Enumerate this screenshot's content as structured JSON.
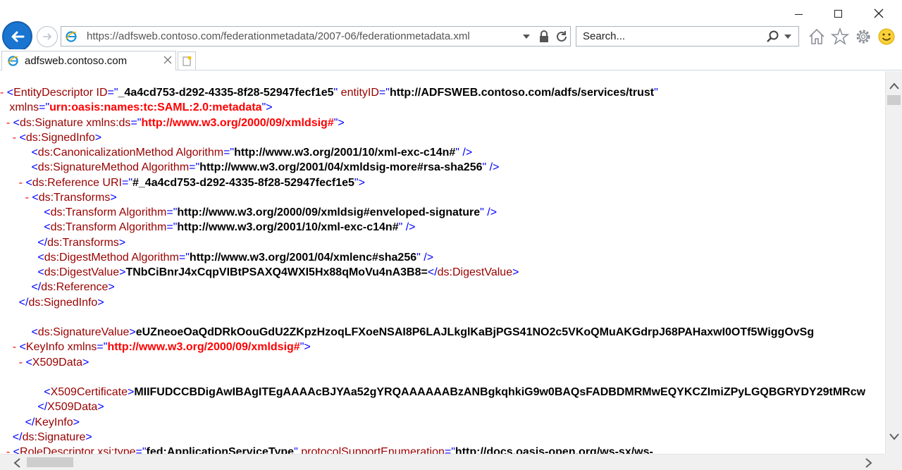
{
  "window": {
    "minimize": "minimize",
    "maximize": "maximize",
    "close": "close"
  },
  "address": {
    "url": "https://adfsweb.contoso.com/federationmetadata/2007-06/federationmetadata.xml"
  },
  "search": {
    "placeholder": "Search..."
  },
  "tab": {
    "title": "adfsweb.contoso.com"
  },
  "icons": {
    "back": "back-arrow-icon",
    "forward": "forward-arrow-icon",
    "page": "ie-page-icon",
    "lock": "lock-icon",
    "refresh": "refresh-icon",
    "search": "search-icon",
    "home": "home-icon",
    "favorites": "star-icon",
    "tools": "gear-icon",
    "feedback": "smiley-icon",
    "new_tab": "new-tab-icon"
  },
  "colors": {
    "markup_minus": "#ff0000",
    "tag": "#990000",
    "bracket": "#0000ff",
    "value": "#000000",
    "namespace_value": "#ff0000",
    "back_button": "#1a75d0"
  },
  "xml_lines": [
    [
      {
        "c": "m",
        "t": "- "
      },
      {
        "c": "b",
        "t": "<"
      },
      {
        "c": "t",
        "t": "EntityDescriptor"
      },
      {
        "c": "a",
        "t": " ID"
      },
      {
        "c": "b",
        "t": "=\""
      },
      {
        "c": "v",
        "t": "_4a4cd753-d292-4335-8f28-52947fecf1e5"
      },
      {
        "c": "b",
        "t": "\""
      },
      {
        "c": "a",
        "t": " entityID"
      },
      {
        "c": "b",
        "t": "=\""
      },
      {
        "c": "v",
        "t": "http://ADFSWEB.contoso.com/adfs/services/trust"
      },
      {
        "c": "b",
        "t": "\""
      }
    ],
    [
      {
        "c": "a",
        "t": "   xmlns"
      },
      {
        "c": "b",
        "t": "=\""
      },
      {
        "c": "vr",
        "t": "urn:oasis:names:tc:SAML:2.0:metadata"
      },
      {
        "c": "b",
        "t": "\">"
      }
    ],
    [
      {
        "c": "m",
        "t": "  - "
      },
      {
        "c": "b",
        "t": "<"
      },
      {
        "c": "t",
        "t": "ds:Signature"
      },
      {
        "c": "a",
        "t": " xmlns:ds"
      },
      {
        "c": "b",
        "t": "=\""
      },
      {
        "c": "vr",
        "t": "http://www.w3.org/2000/09/xmldsig#"
      },
      {
        "c": "b",
        "t": "\">"
      }
    ],
    [
      {
        "c": "m",
        "t": "    - "
      },
      {
        "c": "b",
        "t": "<"
      },
      {
        "c": "t",
        "t": "ds:SignedInfo"
      },
      {
        "c": "b",
        "t": ">"
      }
    ],
    [
      {
        "c": "b",
        "t": "          <"
      },
      {
        "c": "t",
        "t": "ds:CanonicalizationMethod"
      },
      {
        "c": "a",
        "t": " Algorithm"
      },
      {
        "c": "b",
        "t": "=\""
      },
      {
        "c": "v",
        "t": "http://www.w3.org/2001/10/xml-exc-c14n#"
      },
      {
        "c": "b",
        "t": "\" />"
      }
    ],
    [
      {
        "c": "b",
        "t": "          <"
      },
      {
        "c": "t",
        "t": "ds:SignatureMethod"
      },
      {
        "c": "a",
        "t": " Algorithm"
      },
      {
        "c": "b",
        "t": "=\""
      },
      {
        "c": "v",
        "t": "http://www.w3.org/2001/04/xmldsig-more#rsa-sha256"
      },
      {
        "c": "b",
        "t": "\" />"
      }
    ],
    [
      {
        "c": "m",
        "t": "      - "
      },
      {
        "c": "b",
        "t": "<"
      },
      {
        "c": "t",
        "t": "ds:Reference"
      },
      {
        "c": "a",
        "t": " URI"
      },
      {
        "c": "b",
        "t": "=\""
      },
      {
        "c": "v",
        "t": "#_4a4cd753-d292-4335-8f28-52947fecf1e5"
      },
      {
        "c": "b",
        "t": "\">"
      }
    ],
    [
      {
        "c": "m",
        "t": "        - "
      },
      {
        "c": "b",
        "t": "<"
      },
      {
        "c": "t",
        "t": "ds:Transforms"
      },
      {
        "c": "b",
        "t": ">"
      }
    ],
    [
      {
        "c": "b",
        "t": "              <"
      },
      {
        "c": "t",
        "t": "ds:Transform"
      },
      {
        "c": "a",
        "t": " Algorithm"
      },
      {
        "c": "b",
        "t": "=\""
      },
      {
        "c": "v",
        "t": "http://www.w3.org/2000/09/xmldsig#enveloped-signature"
      },
      {
        "c": "b",
        "t": "\" />"
      }
    ],
    [
      {
        "c": "b",
        "t": "              <"
      },
      {
        "c": "t",
        "t": "ds:Transform"
      },
      {
        "c": "a",
        "t": " Algorithm"
      },
      {
        "c": "b",
        "t": "=\""
      },
      {
        "c": "v",
        "t": "http://www.w3.org/2001/10/xml-exc-c14n#"
      },
      {
        "c": "b",
        "t": "\" />"
      }
    ],
    [
      {
        "c": "b",
        "t": "            </"
      },
      {
        "c": "t",
        "t": "ds:Transforms"
      },
      {
        "c": "b",
        "t": ">"
      }
    ],
    [
      {
        "c": "b",
        "t": "            <"
      },
      {
        "c": "t",
        "t": "ds:DigestMethod"
      },
      {
        "c": "a",
        "t": " Algorithm"
      },
      {
        "c": "b",
        "t": "=\""
      },
      {
        "c": "v",
        "t": "http://www.w3.org/2001/04/xmlenc#sha256"
      },
      {
        "c": "b",
        "t": "\" />"
      }
    ],
    [
      {
        "c": "b",
        "t": "            <"
      },
      {
        "c": "t",
        "t": "ds:DigestValue"
      },
      {
        "c": "b",
        "t": ">"
      },
      {
        "c": "tx",
        "t": "TNbCiBnrJ4xCqpVIBtPSAXQ4WXI5Hx88qMoVu4nA3B8="
      },
      {
        "c": "b",
        "t": "</"
      },
      {
        "c": "t",
        "t": "ds:DigestValue"
      },
      {
        "c": "b",
        "t": ">"
      }
    ],
    [
      {
        "c": "b",
        "t": "          </"
      },
      {
        "c": "t",
        "t": "ds:Reference"
      },
      {
        "c": "b",
        "t": ">"
      }
    ],
    [
      {
        "c": "b",
        "t": "      </"
      },
      {
        "c": "t",
        "t": "ds:SignedInfo"
      },
      {
        "c": "b",
        "t": ">"
      }
    ],
    [
      {
        "c": "v",
        "t": " "
      }
    ],
    [
      {
        "c": "b",
        "t": "          <"
      },
      {
        "c": "t",
        "t": "ds:SignatureValue"
      },
      {
        "c": "b",
        "t": ">"
      },
      {
        "c": "tx",
        "t": "eUZneoeOaQdDRkOouGdU2ZKpzHzoqLFXoeNSAI8P6LAJLkglKaBjPGS41NO2c5VKoQMuAKGdrpJ68PAHaxwI0OTf5WiggOvSg"
      }
    ],
    [
      {
        "c": "m",
        "t": "    - "
      },
      {
        "c": "b",
        "t": "<"
      },
      {
        "c": "t",
        "t": "KeyInfo"
      },
      {
        "c": "a",
        "t": " xmlns"
      },
      {
        "c": "b",
        "t": "=\""
      },
      {
        "c": "vr",
        "t": "http://www.w3.org/2000/09/xmldsig#"
      },
      {
        "c": "b",
        "t": "\">"
      }
    ],
    [
      {
        "c": "m",
        "t": "      - "
      },
      {
        "c": "b",
        "t": "<"
      },
      {
        "c": "t",
        "t": "X509Data"
      },
      {
        "c": "b",
        "t": ">"
      }
    ],
    [
      {
        "c": "v",
        "t": " "
      }
    ],
    [
      {
        "c": "b",
        "t": "              <"
      },
      {
        "c": "t",
        "t": "X509Certificate"
      },
      {
        "c": "b",
        "t": ">"
      },
      {
        "c": "tx",
        "t": "MIIFUDCCBDigAwIBAgITEgAAAAcBJYAa52gYRQAAAAAABzANBgkqhkiG9w0BAQsFADBDMRMwEQYKCZImiZPyLGQBGRYDY29tMRcw"
      }
    ],
    [
      {
        "c": "b",
        "t": "            </"
      },
      {
        "c": "t",
        "t": "X509Data"
      },
      {
        "c": "b",
        "t": ">"
      }
    ],
    [
      {
        "c": "b",
        "t": "        </"
      },
      {
        "c": "t",
        "t": "KeyInfo"
      },
      {
        "c": "b",
        "t": ">"
      }
    ],
    [
      {
        "c": "b",
        "t": "    </"
      },
      {
        "c": "t",
        "t": "ds:Signature"
      },
      {
        "c": "b",
        "t": ">"
      }
    ],
    [
      {
        "c": "m",
        "t": "  - "
      },
      {
        "c": "b",
        "t": "<"
      },
      {
        "c": "t",
        "t": "RoleDescriptor"
      },
      {
        "c": "a",
        "t": " xsi:type"
      },
      {
        "c": "b",
        "t": "=\""
      },
      {
        "c": "v",
        "t": "fed:ApplicationServiceType"
      },
      {
        "c": "b",
        "t": "\""
      },
      {
        "c": "a",
        "t": " protocolSupportEnumeration"
      },
      {
        "c": "b",
        "t": "=\""
      },
      {
        "c": "v",
        "t": "http://docs.oasis-open.org/ws-sx/ws-"
      }
    ]
  ]
}
